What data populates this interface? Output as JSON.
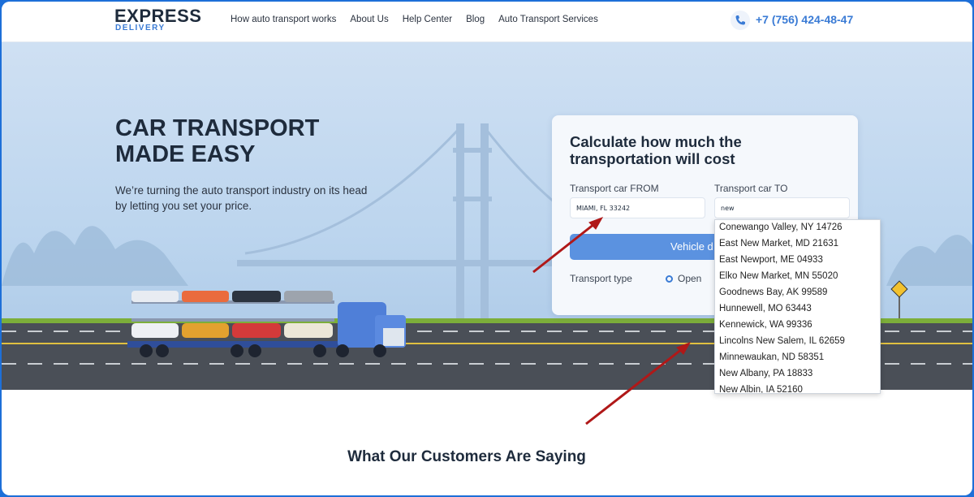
{
  "logo": {
    "main": "EXPRESS",
    "sub": "DELIVERY"
  },
  "nav": [
    "How auto transport works",
    "About Us",
    "Help Center",
    "Blog",
    "Auto Transport Services"
  ],
  "phone": "+7 (756) 424-48-47",
  "hero": {
    "title": "CAR TRANSPORT\nMADE EASY",
    "subtitle": "We’re turning the auto transport industry on its head by letting you set your price."
  },
  "calculator": {
    "title": "Calculate how much the transportation will cost",
    "from_label": "Transport car FROM",
    "from_value": "MIAMI, FL 33242",
    "to_label": "Transport car TO",
    "to_value": "new",
    "button_label": "Vehicle d",
    "type_label": "Transport type",
    "type_option": "Open"
  },
  "suggestions": [
    "Conewango Valley, NY 14726",
    "East New Market, MD 21631",
    "East Newport, ME 04933",
    "Elko New Market, MN 55020",
    "Goodnews Bay, AK 99589",
    "Hunnewell, MO 63443",
    "Kennewick, WA 99336",
    "Lincolns New Salem, IL 62659",
    "Minnewaukan, ND 58351",
    "New Albany, PA 18833",
    "New Albin, IA 52160"
  ],
  "section_title": "What Our Customers Are Saying",
  "colors": {
    "accent": "#3a7bd5",
    "arrow": "#b01818",
    "road": "#4a4f57"
  }
}
